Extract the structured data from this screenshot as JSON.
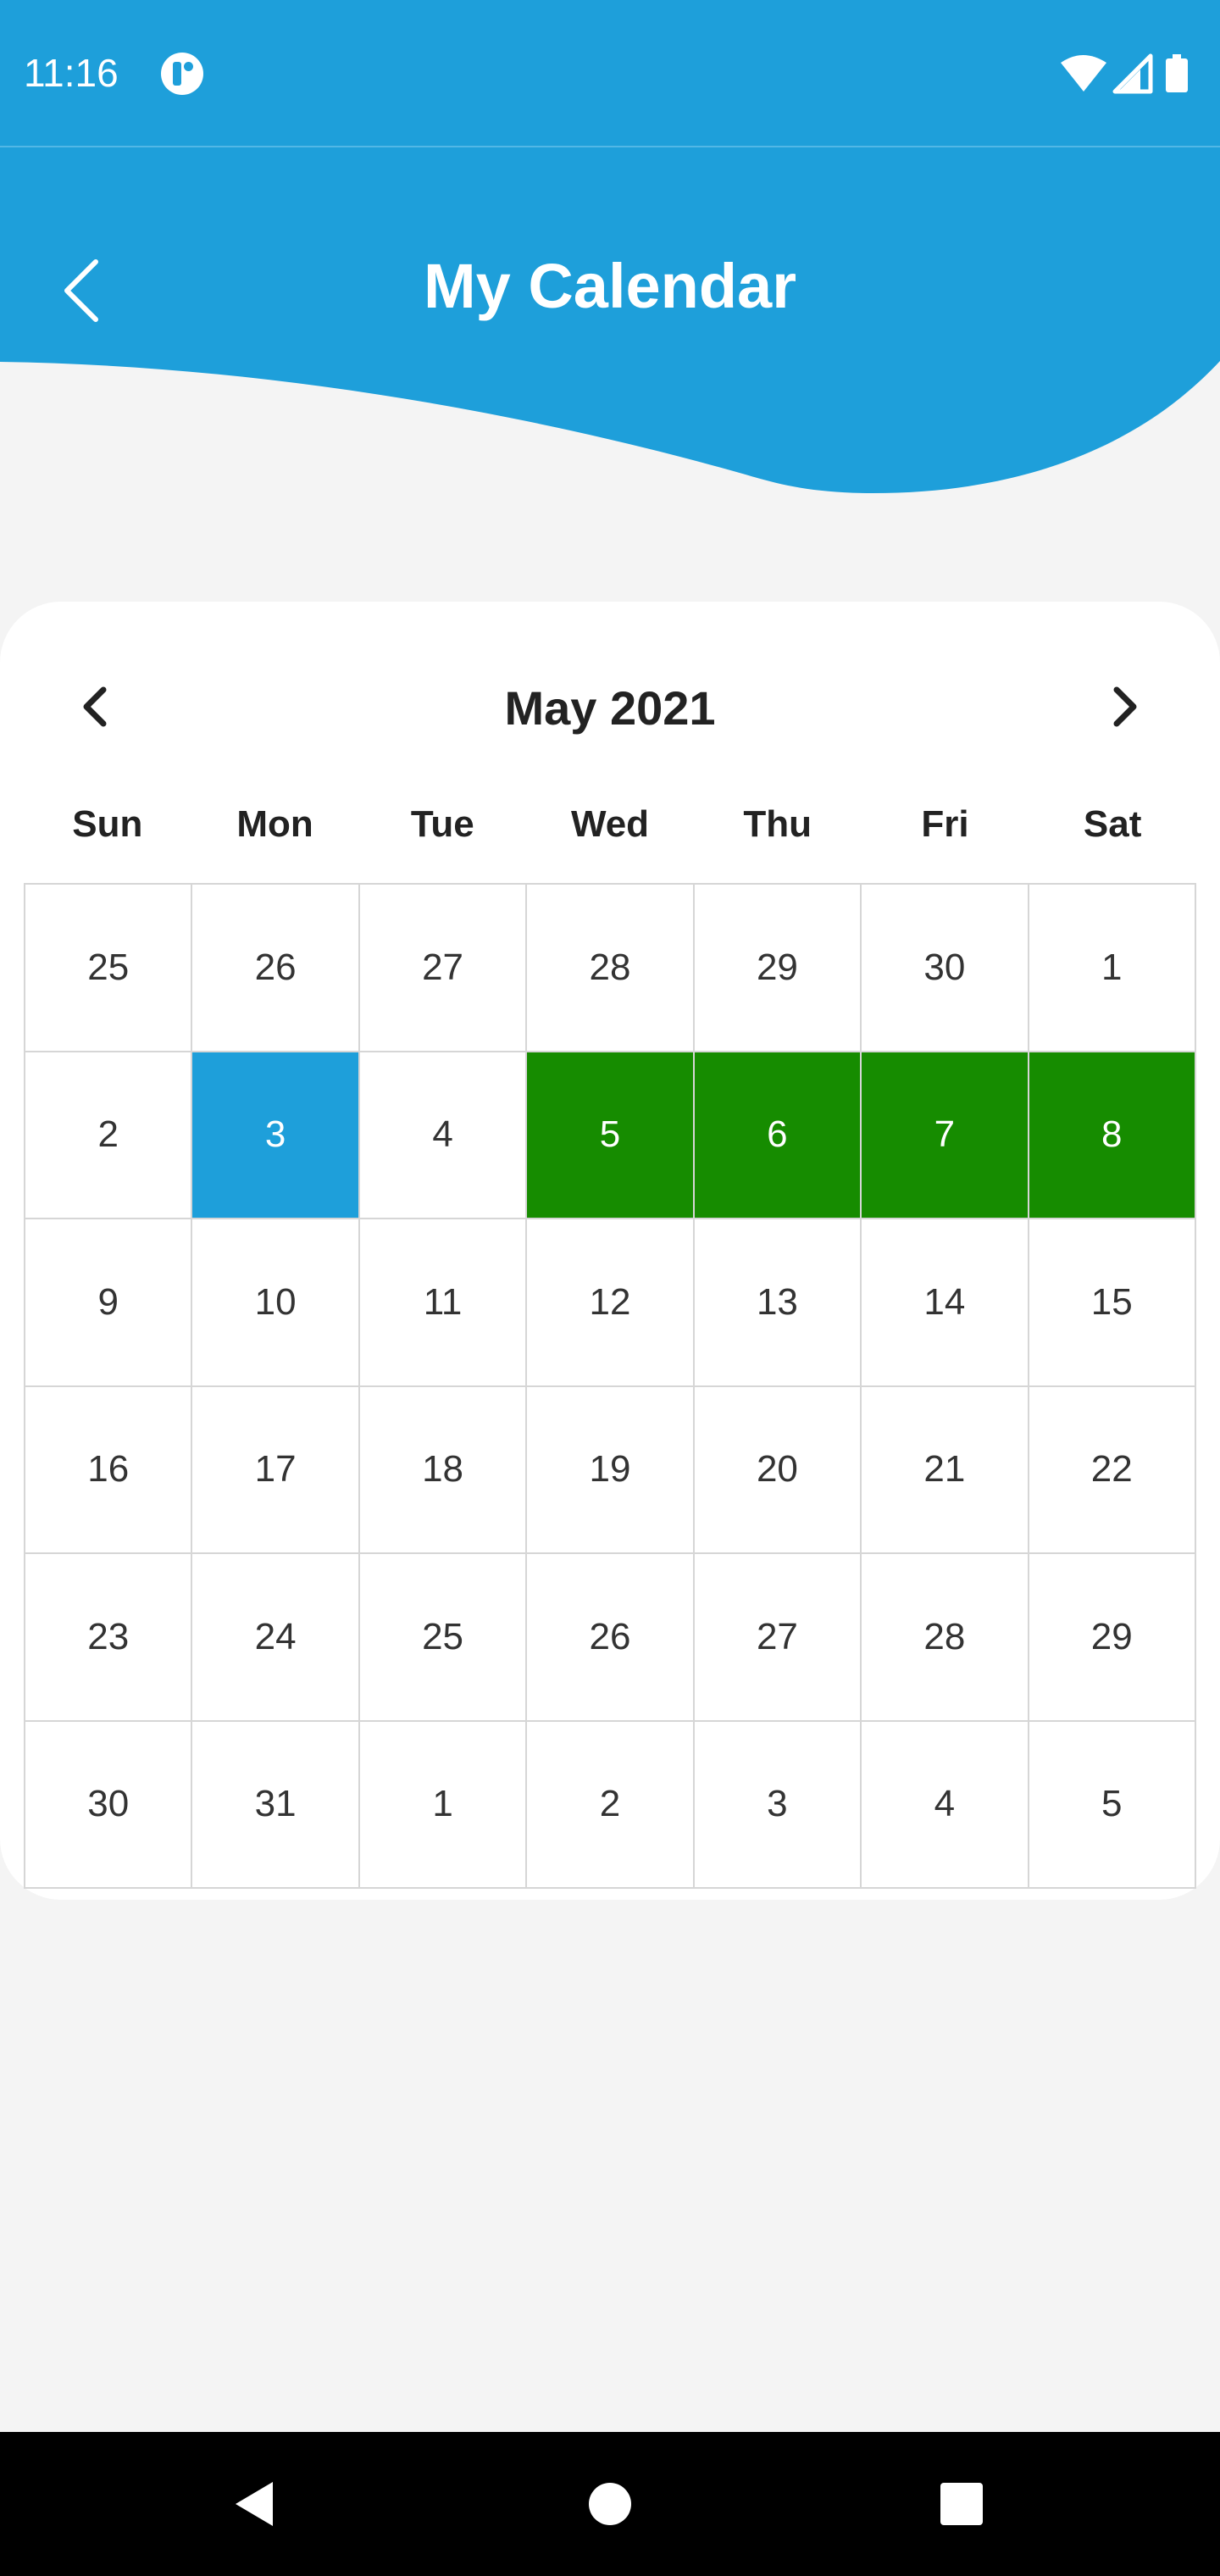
{
  "status_bar": {
    "time": "11:16",
    "icons": [
      "app-notification-icon",
      "wifi-icon",
      "cellular-signal-icon",
      "battery-icon"
    ]
  },
  "header": {
    "title": "My Calendar",
    "back_icon": "chevron-left-icon",
    "color": "#1e9fda"
  },
  "calendar": {
    "month_label": "May 2021",
    "prev_icon": "chevron-left-icon",
    "next_icon": "chevron-right-icon",
    "weekdays": [
      "Sun",
      "Mon",
      "Tue",
      "Wed",
      "Thu",
      "Fri",
      "Sat"
    ],
    "weeks": [
      [
        {
          "day": "25",
          "state": "normal"
        },
        {
          "day": "26",
          "state": "normal"
        },
        {
          "day": "27",
          "state": "normal"
        },
        {
          "day": "28",
          "state": "normal"
        },
        {
          "day": "29",
          "state": "normal"
        },
        {
          "day": "30",
          "state": "normal"
        },
        {
          "day": "1",
          "state": "normal"
        }
      ],
      [
        {
          "day": "2",
          "state": "normal"
        },
        {
          "day": "3",
          "state": "selected"
        },
        {
          "day": "4",
          "state": "normal"
        },
        {
          "day": "5",
          "state": "booked"
        },
        {
          "day": "6",
          "state": "booked"
        },
        {
          "day": "7",
          "state": "booked"
        },
        {
          "day": "8",
          "state": "booked"
        }
      ],
      [
        {
          "day": "9",
          "state": "normal"
        },
        {
          "day": "10",
          "state": "normal"
        },
        {
          "day": "11",
          "state": "normal"
        },
        {
          "day": "12",
          "state": "normal"
        },
        {
          "day": "13",
          "state": "normal"
        },
        {
          "day": "14",
          "state": "normal"
        },
        {
          "day": "15",
          "state": "normal"
        }
      ],
      [
        {
          "day": "16",
          "state": "normal"
        },
        {
          "day": "17",
          "state": "normal"
        },
        {
          "day": "18",
          "state": "normal"
        },
        {
          "day": "19",
          "state": "normal"
        },
        {
          "day": "20",
          "state": "normal"
        },
        {
          "day": "21",
          "state": "normal"
        },
        {
          "day": "22",
          "state": "normal"
        }
      ],
      [
        {
          "day": "23",
          "state": "normal"
        },
        {
          "day": "24",
          "state": "normal"
        },
        {
          "day": "25",
          "state": "normal"
        },
        {
          "day": "26",
          "state": "normal"
        },
        {
          "day": "27",
          "state": "normal"
        },
        {
          "day": "28",
          "state": "normal"
        },
        {
          "day": "29",
          "state": "normal"
        }
      ],
      [
        {
          "day": "30",
          "state": "normal"
        },
        {
          "day": "31",
          "state": "normal"
        },
        {
          "day": "1",
          "state": "normal"
        },
        {
          "day": "2",
          "state": "normal"
        },
        {
          "day": "3",
          "state": "normal"
        },
        {
          "day": "4",
          "state": "normal"
        },
        {
          "day": "5",
          "state": "normal"
        }
      ]
    ],
    "colors": {
      "selected": "#1e9fda",
      "booked": "#168c00",
      "grid_line": "#d6d6d6"
    }
  },
  "nav_bar": {
    "buttons": [
      "back-triangle-icon",
      "home-circle-icon",
      "recents-square-icon"
    ]
  }
}
